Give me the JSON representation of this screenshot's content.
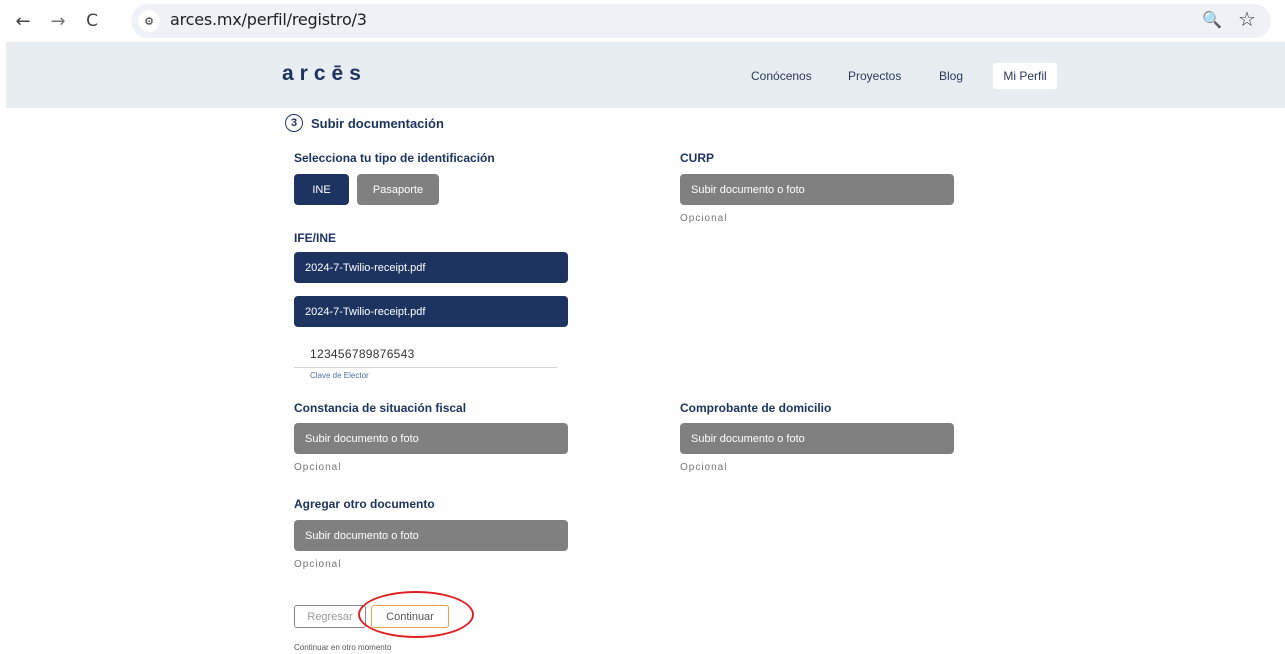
{
  "browser": {
    "back_icon": "←",
    "forward_icon": "→",
    "reload_icon": "C",
    "site_info_icon": "⚙",
    "url": "arces.mx/perfil/registro/3",
    "zoom_icon": "🔍",
    "star_icon": "☆"
  },
  "header": {
    "logo": "arcēs",
    "nav": [
      "Conócenos",
      "Proyectos",
      "Blog"
    ],
    "profile_button": "Mi Perfil"
  },
  "step": {
    "number": "3",
    "title": "Subir documentación"
  },
  "identification": {
    "label": "Selecciona tu tipo de identificación",
    "options": [
      "INE",
      "Pasaporte"
    ],
    "selected": "INE"
  },
  "curp": {
    "label": "CURP",
    "upload_label": "Subir documento o foto",
    "note": "Opcional"
  },
  "ife_ine": {
    "label": "IFE/INE",
    "file_front": "2024-7-Twilio-receipt.pdf",
    "file_back": "2024-7-Twilio-receipt.pdf",
    "clave_value": "123456789876543",
    "clave_label": "Clave de Elector"
  },
  "constancia": {
    "label": "Constancia de situación fiscal",
    "upload_label": "Subir documento o foto",
    "note": "Opcional"
  },
  "comprobante": {
    "label": "Comprobante de domicilio",
    "upload_label": "Subir documento o foto",
    "note": "Opcional"
  },
  "otro": {
    "label": "Agregar otro documento",
    "upload_label": "Subir documento o foto",
    "note": "Opcional"
  },
  "actions": {
    "back_label": "Regresar",
    "continue_label": "Continuar",
    "later_label": "Continuar en otro momento"
  },
  "colors": {
    "primary": "#1d3461",
    "upload_gray": "#808080",
    "header_bg": "#e8edf2",
    "continue_border": "#e8a24a",
    "highlight": "#e02020"
  }
}
